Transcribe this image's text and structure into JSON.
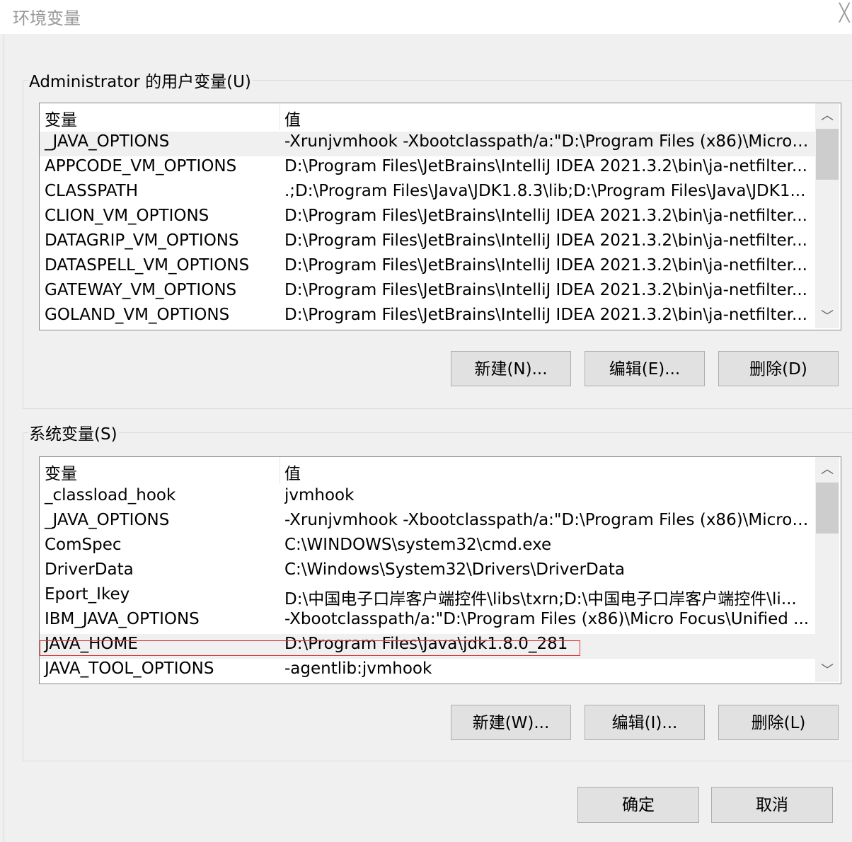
{
  "window": {
    "title": "环境变量",
    "close_glyph": "╳"
  },
  "user_vars": {
    "group_title": "Administrator 的用户变量(U)",
    "columns": [
      "变量",
      "值"
    ],
    "rows": [
      {
        "name": "_JAVA_OPTIONS",
        "value": "-Xrunjvmhook -Xbootclasspath/a:\"D:\\Program Files (x86)\\Micro ..."
      },
      {
        "name": "APPCODE_VM_OPTIONS",
        "value": "D:\\Program Files\\JetBrains\\IntelliJ IDEA 2021.3.2\\bin\\ja-netfilter..."
      },
      {
        "name": "CLASSPATH",
        "value": ".;D:\\Program Files\\Java\\JDK1.8.3\\lib;D:\\Program Files\\Java\\JDK1..."
      },
      {
        "name": "CLION_VM_OPTIONS",
        "value": "D:\\Program Files\\JetBrains\\IntelliJ IDEA 2021.3.2\\bin\\ja-netfilter..."
      },
      {
        "name": "DATAGRIP_VM_OPTIONS",
        "value": "D:\\Program Files\\JetBrains\\IntelliJ IDEA 2021.3.2\\bin\\ja-netfilter..."
      },
      {
        "name": "DATASPELL_VM_OPTIONS",
        "value": "D:\\Program Files\\JetBrains\\IntelliJ IDEA 2021.3.2\\bin\\ja-netfilter..."
      },
      {
        "name": "GATEWAY_VM_OPTIONS",
        "value": "D:\\Program Files\\JetBrains\\IntelliJ IDEA 2021.3.2\\bin\\ja-netfilter..."
      },
      {
        "name": "GOLAND_VM_OPTIONS",
        "value": "D:\\Program Files\\JetBrains\\IntelliJ IDEA 2021.3.2\\bin\\ja-netfilter..."
      }
    ],
    "buttons": {
      "new": "新建(N)...",
      "edit": "编辑(E)...",
      "delete": "删除(D)"
    }
  },
  "system_vars": {
    "group_title": "系统变量(S)",
    "columns": [
      "变量",
      "值"
    ],
    "rows": [
      {
        "name": "_classload_hook",
        "value": "jvmhook"
      },
      {
        "name": "_JAVA_OPTIONS",
        "value": "-Xrunjvmhook -Xbootclasspath/a:\"D:\\Program Files (x86)\\Micro ..."
      },
      {
        "name": "ComSpec",
        "value": "C:\\WINDOWS\\system32\\cmd.exe"
      },
      {
        "name": "DriverData",
        "value": "C:\\Windows\\System32\\Drivers\\DriverData"
      },
      {
        "name": "Eport_Ikey",
        "value": "D:\\中国电子口岸客户端控件\\libs\\txrn;D:\\中国电子口岸客户端控件\\li..."
      },
      {
        "name": "IBM_JAVA_OPTIONS",
        "value": "-Xbootclasspath/a:\"D:\\Program Files (x86)\\Micro Focus\\Unified ..."
      },
      {
        "name": "JAVA_HOME",
        "value": "D:\\Program Files\\Java\\jdk1.8.0_281"
      },
      {
        "name": "JAVA_TOOL_OPTIONS",
        "value": "-agentlib:jvmhook"
      }
    ],
    "buttons": {
      "new": "新建(W)...",
      "edit": "编辑(I)...",
      "delete": "删除(L)"
    }
  },
  "footer": {
    "ok": "确定",
    "cancel": "取消"
  },
  "scroll_glyphs": {
    "up": "︿",
    "down": "﹀"
  },
  "colors": {
    "highlight_outline": "#e03030",
    "selected_row": "#f0f0f0"
  }
}
